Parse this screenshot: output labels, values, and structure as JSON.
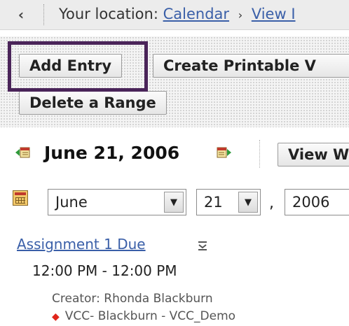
{
  "breadcrumb": {
    "back_icon": "chevron-left-icon",
    "prefix": "Your location:",
    "items": [
      "Calendar",
      "View I"
    ],
    "separator": "›"
  },
  "toolbar": {
    "add_entry": "Add Entry",
    "create_printable": "Create Printable V",
    "delete_range": "Delete a Range",
    "highlight_color": "#4a2459"
  },
  "date_nav": {
    "prev_icon": "previous-day-icon",
    "title": "June 21, 2006",
    "next_icon": "next-day-icon",
    "view_button": "View W"
  },
  "date_picker": {
    "calendar_icon": "calendar-icon",
    "month": "June",
    "day": "21",
    "separator": ",",
    "year": "2006"
  },
  "event": {
    "title": "Assignment 1 Due",
    "menu_icon": "menu-dropdown-icon",
    "time": "12:00 PM - 12:00 PM",
    "creator": "Creator: Rhonda Blackburn",
    "course": "VCC- Blackburn - VCC_Demo",
    "course_marker_color": "#e0261b"
  }
}
